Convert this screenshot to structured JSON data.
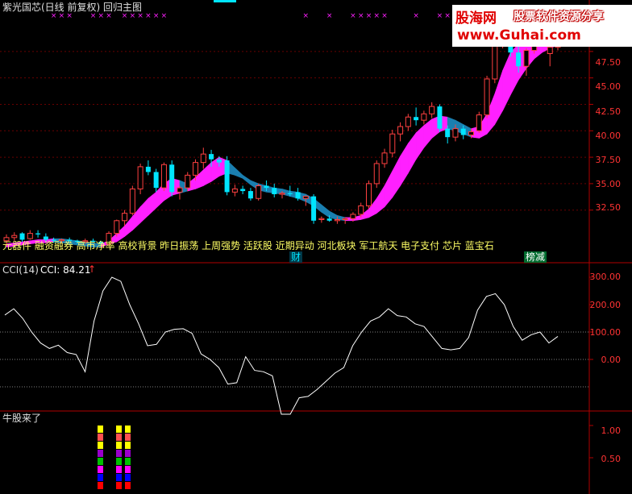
{
  "header": {
    "title": "紫光国芯(日线 前复权) 回归主图"
  },
  "watermark": {
    "name": "股海网",
    "tagline": "股票软件资源分享",
    "url": "www.Guhai.com"
  },
  "concept_text": "元器件 融资融券 高市净率 高校背景 昨日振荡 上周强势 活跃股 近期异动 河北板块 军工航天 电子支付 芯片 蓝宝石",
  "badges": {
    "cai": "财",
    "bangjian": "榜减"
  },
  "cci_panel": {
    "label": "CCI(14)",
    "value_text": "CCI: 84.21",
    "arrow": "↑"
  },
  "bull_panel": {
    "label": "牛股来了"
  },
  "colors": {
    "up": "#ff4040",
    "down": "#00e5ff",
    "band_up": "#ff20ff",
    "band_down": "#1a7fb0",
    "axis": "#b00000",
    "cci_line": "#ffffff",
    "tick_text": "#ff3333"
  },
  "chart_data": [
    {
      "type": "candlestick",
      "name": "price",
      "ylim": [
        29.2,
        51.3
      ],
      "yticks": [
        "32.50",
        "35.00",
        "37.50",
        "40.00",
        "42.50",
        "45.00",
        "47.50"
      ],
      "ohlc": [
        [
          29.6,
          30.2,
          29.1,
          29.9
        ],
        [
          29.9,
          30.4,
          29.6,
          30.1
        ],
        [
          30.3,
          30.4,
          29.5,
          29.7
        ],
        [
          29.8,
          30.6,
          29.7,
          30.3
        ],
        [
          30.3,
          30.6,
          29.9,
          30.2
        ],
        [
          30.0,
          30.3,
          29.5,
          29.7
        ],
        [
          29.7,
          29.9,
          29.4,
          29.6
        ],
        [
          29.6,
          29.8,
          29.4,
          29.7
        ],
        [
          29.7,
          29.9,
          29.5,
          29.6
        ],
        [
          29.6,
          29.7,
          29.3,
          29.5
        ],
        [
          29.5,
          29.8,
          29.3,
          29.6
        ],
        [
          29.6,
          29.8,
          29.4,
          29.5
        ],
        [
          29.5,
          29.6,
          29.2,
          29.3
        ],
        [
          29.3,
          30.5,
          29.2,
          30.3
        ],
        [
          30.3,
          31.6,
          30.0,
          31.5
        ],
        [
          31.5,
          32.5,
          31.0,
          32.2
        ],
        [
          32.2,
          34.8,
          32.0,
          34.5
        ],
        [
          34.5,
          36.9,
          34.0,
          36.6
        ],
        [
          36.6,
          37.2,
          35.8,
          36.1
        ],
        [
          36.1,
          36.4,
          34.2,
          34.6
        ],
        [
          34.6,
          37.0,
          34.3,
          36.8
        ],
        [
          36.8,
          37.2,
          33.8,
          34.2
        ],
        [
          34.2,
          34.8,
          33.5,
          34.6
        ],
        [
          34.6,
          36.1,
          34.3,
          35.8
        ],
        [
          35.8,
          37.3,
          35.3,
          37.0
        ],
        [
          37.0,
          38.4,
          36.4,
          37.8
        ],
        [
          37.8,
          38.2,
          36.6,
          37.3
        ],
        [
          37.3,
          37.6,
          36.6,
          37.0
        ],
        [
          37.2,
          37.6,
          33.9,
          34.2
        ],
        [
          34.2,
          34.9,
          33.8,
          34.5
        ],
        [
          34.5,
          34.8,
          34.0,
          34.3
        ],
        [
          34.3,
          34.6,
          33.4,
          33.6
        ],
        [
          33.6,
          35.0,
          33.4,
          34.8
        ],
        [
          34.8,
          35.3,
          34.3,
          34.6
        ],
        [
          34.6,
          35.0,
          33.7,
          34.0
        ],
        [
          34.0,
          34.3,
          33.6,
          34.1
        ],
        [
          34.1,
          34.8,
          33.8,
          34.0
        ],
        [
          34.2,
          34.6,
          33.4,
          33.6
        ],
        [
          33.6,
          33.9,
          32.9,
          33.8
        ],
        [
          33.8,
          34.0,
          31.2,
          31.5
        ],
        [
          31.6,
          31.9,
          31.3,
          31.7
        ],
        [
          31.7,
          32.0,
          31.4,
          31.5
        ],
        [
          31.5,
          31.9,
          31.2,
          31.6
        ],
        [
          31.6,
          31.8,
          31.2,
          31.7
        ],
        [
          31.7,
          32.3,
          31.4,
          32.1
        ],
        [
          32.1,
          33.2,
          31.8,
          32.9
        ],
        [
          32.9,
          35.3,
          32.6,
          35.0
        ],
        [
          35.0,
          37.2,
          34.6,
          36.9
        ],
        [
          36.9,
          38.3,
          36.5,
          37.9
        ],
        [
          37.9,
          40.1,
          37.5,
          39.7
        ],
        [
          39.7,
          40.8,
          39.0,
          40.4
        ],
        [
          40.4,
          41.6,
          40.0,
          41.3
        ],
        [
          41.3,
          42.2,
          40.5,
          41.0
        ],
        [
          41.0,
          41.9,
          40.6,
          41.6
        ],
        [
          41.6,
          42.7,
          41.2,
          42.3
        ],
        [
          42.3,
          42.5,
          39.9,
          40.2
        ],
        [
          40.2,
          40.5,
          38.8,
          39.4
        ],
        [
          39.4,
          40.6,
          39.0,
          40.2
        ],
        [
          40.2,
          40.5,
          39.2,
          39.6
        ],
        [
          39.6,
          40.2,
          39.3,
          39.9
        ],
        [
          40.0,
          41.8,
          39.8,
          41.5
        ],
        [
          41.5,
          45.2,
          41.2,
          44.9
        ],
        [
          44.9,
          48.6,
          44.5,
          48.1
        ],
        [
          48.1,
          51.5,
          47.8,
          51.0
        ],
        [
          51.0,
          51.5,
          47.0,
          47.4
        ],
        [
          47.4,
          48.2,
          45.5,
          46.1
        ],
        [
          46.1,
          47.8,
          45.2,
          47.6
        ],
        [
          47.6,
          49.8,
          47.3,
          49.5
        ],
        [
          49.5,
          50.2,
          48.3,
          48.7
        ],
        [
          47.3,
          48.2,
          46.1,
          47.9
        ],
        [
          47.9,
          50.2,
          47.6,
          49.8
        ]
      ],
      "band": [
        [
          29.3,
          29.0
        ],
        [
          29.4,
          29.1
        ],
        [
          29.5,
          29.2
        ],
        [
          29.6,
          29.3
        ],
        [
          29.7,
          29.4
        ],
        [
          29.7,
          29.4
        ],
        [
          29.8,
          29.5
        ],
        [
          29.8,
          29.4
        ],
        [
          29.7,
          29.3
        ],
        [
          29.6,
          29.2
        ],
        [
          29.5,
          29.1
        ],
        [
          29.4,
          29.0
        ],
        [
          29.3,
          29.0
        ],
        [
          29.6,
          29.3
        ],
        [
          30.3,
          29.5
        ],
        [
          31.0,
          30.0
        ],
        [
          31.9,
          30.6
        ],
        [
          32.8,
          31.3
        ],
        [
          33.6,
          32.0
        ],
        [
          34.2,
          32.7
        ],
        [
          35.0,
          33.4
        ],
        [
          35.5,
          33.9
        ],
        [
          35.3,
          34.1
        ],
        [
          35.0,
          34.3
        ],
        [
          35.6,
          34.5
        ],
        [
          36.3,
          34.8
        ],
        [
          37.0,
          35.2
        ],
        [
          37.5,
          35.7
        ],
        [
          37.2,
          36.0
        ],
        [
          36.5,
          35.8
        ],
        [
          35.8,
          35.5
        ],
        [
          35.3,
          34.9
        ],
        [
          35.0,
          34.4
        ],
        [
          34.8,
          34.2
        ],
        [
          34.6,
          34.1
        ],
        [
          34.5,
          34.0
        ],
        [
          34.3,
          33.8
        ],
        [
          34.2,
          33.6
        ],
        [
          34.0,
          33.3
        ],
        [
          33.6,
          32.9
        ],
        [
          33.0,
          32.3
        ],
        [
          32.4,
          31.8
        ],
        [
          32.0,
          31.6
        ],
        [
          31.8,
          31.5
        ],
        [
          31.8,
          31.5
        ],
        [
          32.0,
          31.6
        ],
        [
          32.6,
          31.8
        ],
        [
          33.6,
          32.2
        ],
        [
          34.8,
          32.8
        ],
        [
          36.2,
          33.7
        ],
        [
          37.6,
          34.8
        ],
        [
          38.8,
          36.0
        ],
        [
          39.8,
          37.3
        ],
        [
          40.5,
          38.4
        ],
        [
          41.1,
          39.3
        ],
        [
          41.4,
          39.9
        ],
        [
          41.3,
          40.2
        ],
        [
          41.0,
          40.0
        ],
        [
          40.6,
          39.7
        ],
        [
          40.2,
          39.4
        ],
        [
          40.4,
          39.3
        ],
        [
          41.6,
          39.7
        ],
        [
          43.5,
          40.6
        ],
        [
          45.7,
          41.9
        ],
        [
          47.4,
          43.4
        ],
        [
          48.2,
          44.8
        ],
        [
          48.5,
          45.9
        ],
        [
          48.8,
          46.8
        ],
        [
          49.0,
          47.4
        ],
        [
          49.2,
          47.8
        ],
        [
          49.6,
          48.1
        ]
      ]
    },
    {
      "type": "line",
      "name": "CCI(14)",
      "ylim": [
        -250,
        350
      ],
      "yticks": [
        "100.00",
        "200.00",
        "300.00",
        "0.00"
      ],
      "reference_lines": [
        100,
        0,
        -100
      ],
      "values": [
        162,
        185,
        150,
        100,
        60,
        40,
        52,
        25,
        18,
        -45,
        140,
        250,
        300,
        285,
        200,
        130,
        50,
        55,
        100,
        110,
        112,
        95,
        20,
        0,
        -30,
        -90,
        -85,
        10,
        -40,
        -45,
        -60,
        -200,
        -200,
        -140,
        -135,
        -110,
        -80,
        -50,
        -30,
        50,
        100,
        140,
        155,
        185,
        160,
        155,
        130,
        120,
        80,
        40,
        35,
        40,
        80,
        180,
        230,
        240,
        200,
        120,
        70,
        90,
        100,
        60,
        84
      ]
    },
    {
      "type": "bar",
      "name": "牛股来了",
      "ylim": [
        0,
        1.2
      ],
      "yticks": [
        "0.50",
        "1.00"
      ],
      "segments": [
        "#ff0000",
        "#0000ff",
        "#ff00ff",
        "#00c000",
        "#9900cc",
        "#ffff00",
        "#ff5050",
        "#ffff00"
      ],
      "bars": [
        1,
        1,
        1
      ]
    }
  ]
}
